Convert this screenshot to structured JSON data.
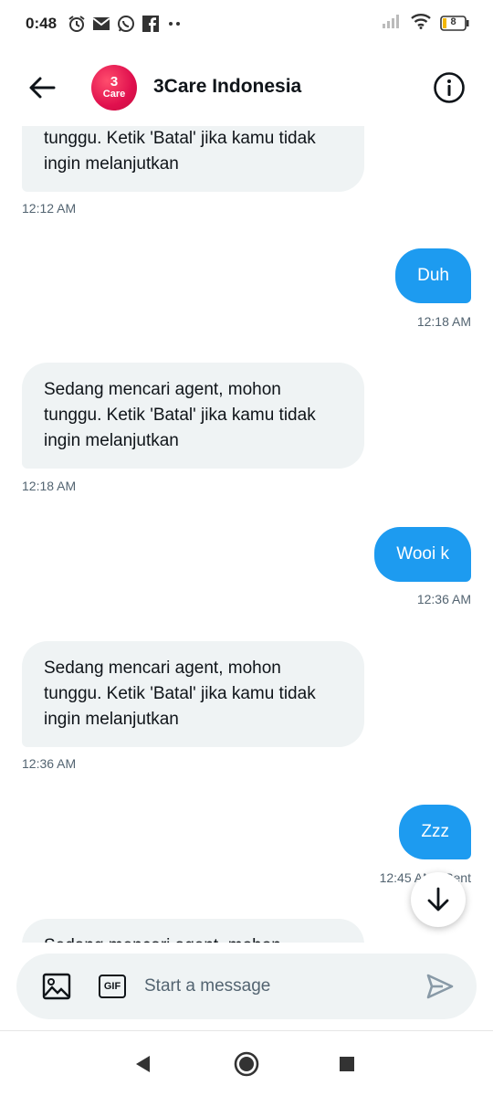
{
  "status_bar": {
    "time": "0:48",
    "battery": "8",
    "icons": [
      "alarm-icon",
      "gmail-icon",
      "whatsapp-icon",
      "facebook-icon",
      "more-dots-icon"
    ]
  },
  "header": {
    "back_icon": "arrow-left-icon",
    "avatar_digit": "3",
    "avatar_text": "Care",
    "contact_name": "3Care Indonesia",
    "info_icon": "info-icon"
  },
  "messages": [
    {
      "side": "in",
      "lines": [
        "tunggu. Ketik 'Batal' jika kamu tidak",
        "ingin melanjutkan"
      ],
      "time": "12:12 AM"
    },
    {
      "side": "out",
      "text": "Duh",
      "time": "12:18 AM"
    },
    {
      "side": "in",
      "lines": [
        "Sedang mencari agent, mohon",
        "tunggu. Ketik 'Batal' jika kamu tidak",
        "ingin melanjutkan"
      ],
      "time": "12:18 AM"
    },
    {
      "side": "out",
      "text": "Wooi k",
      "time": "12:36 AM"
    },
    {
      "side": "in",
      "lines": [
        "Sedang mencari agent, mohon",
        "tunggu. Ketik 'Batal' jika kamu tidak",
        "ingin melanjutkan"
      ],
      "time": "12:36 AM"
    },
    {
      "side": "out",
      "text": "Zzz",
      "time": "12:45 AM · Sent"
    },
    {
      "side": "in",
      "lines": [
        "Sedang mencari agent, mohon"
      ],
      "time": ""
    }
  ],
  "composer": {
    "placeholder": "Start a message",
    "gif_label": "GIF",
    "icons": [
      "image-icon",
      "gif-icon",
      "send-icon"
    ]
  },
  "scroll_down_icon": "arrow-down-icon",
  "nav": {
    "icons": [
      "nav-back-icon",
      "nav-home-icon",
      "nav-recents-icon"
    ]
  }
}
